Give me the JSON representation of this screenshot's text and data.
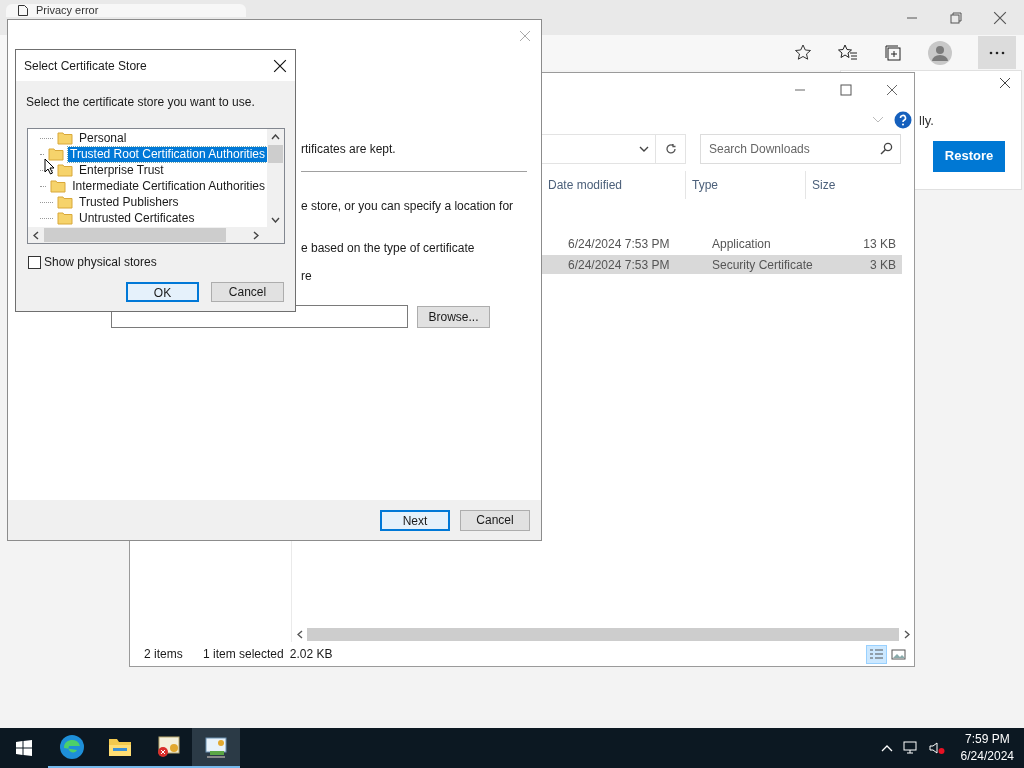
{
  "browser": {
    "tab": {
      "title": "Privacy error"
    },
    "notification": {
      "text": "lly.",
      "button": "Restore"
    }
  },
  "explorer": {
    "search": {
      "placeholder": "Search Downloads"
    },
    "columns": [
      "Date modified",
      "Type",
      "Size"
    ],
    "rows": [
      {
        "date": "6/24/2024 7:53 PM",
        "type": "Application",
        "size": "13 KB",
        "selected": false
      },
      {
        "date": "6/24/2024 7:53 PM",
        "type": "Security Certificate",
        "size": "3 KB",
        "selected": true
      }
    ],
    "status": {
      "count": "2 items",
      "selection": "1 item selected",
      "size": "2.02 KB"
    },
    "views": [
      {
        "kind": "details",
        "selected": true
      },
      {
        "kind": "thumbnails",
        "selected": false
      }
    ]
  },
  "wizard": {
    "lines": [
      "rtificates are kept.",
      "e store, or you can specify a location for",
      "e based on the type of certificate",
      "re"
    ],
    "browse": "Browse...",
    "next": "Next",
    "cancel": "Cancel"
  },
  "store_dialog": {
    "title": "Select Certificate Store",
    "prompt": "Select the certificate store you want to use.",
    "stores": [
      {
        "name": "Personal",
        "selected": false
      },
      {
        "name": "Trusted Root Certification Authorities",
        "selected": true
      },
      {
        "name": "Enterprise Trust",
        "selected": false
      },
      {
        "name": "Intermediate Certification Authorities",
        "selected": false
      },
      {
        "name": "Trusted Publishers",
        "selected": false
      },
      {
        "name": "Untrusted Certificates",
        "selected": false
      }
    ],
    "show_physical": {
      "label": "Show physical stores",
      "checked": false
    },
    "ok": "OK",
    "cancel": "Cancel"
  },
  "taskbar": {
    "apps": [
      {
        "kind": "edge",
        "selected": false
      },
      {
        "kind": "folder",
        "selected": false
      },
      {
        "kind": "cert-error",
        "selected": false
      },
      {
        "kind": "cert-manager",
        "selected": true
      }
    ],
    "time": "7:59 PM",
    "date": "6/24/2024"
  }
}
